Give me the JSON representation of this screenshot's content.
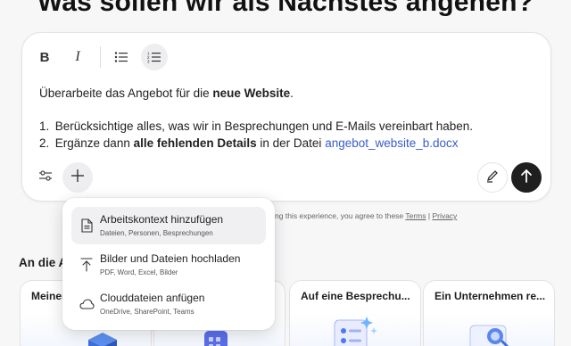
{
  "headline": "Was sollen wir als Nächstes angehen?",
  "toolbar": {
    "bold_label": "B",
    "italic_label": "I"
  },
  "editor": {
    "line1_prefix": "Überarbeite das Angebot für die ",
    "line1_bold": "neue Website",
    "line1_suffix": ".",
    "item1_number": "1.",
    "item1_text": "Berücksichtige alles, was wir in Besprechungen und E-Mails vereinbart haben.",
    "item2_number": "2.",
    "item2_prefix": "Ergänze dann ",
    "item2_bold": "alle fehlenden Details",
    "item2_middle": " in der Datei ",
    "item2_file": "angebot_website_b.docx"
  },
  "disclaimer": {
    "text": "ising this experience, you agree to these ",
    "terms": "Terms",
    "separator": " | ",
    "privacy": "Privacy"
  },
  "section_label": "An die A",
  "cards": [
    {
      "title": "Meiner"
    },
    {
      "title": ""
    },
    {
      "title": "Auf eine Besprechu..."
    },
    {
      "title": "Ein Unternehmen re..."
    }
  ],
  "popup": {
    "items": [
      {
        "title": "Arbeitskontext hinzufügen",
        "subtitle": "Dateien, Personen, Besprechungen",
        "icon": "document-icon"
      },
      {
        "title": "Bilder und Dateien hochladen",
        "subtitle": "PDF, Word, Excel, Bilder",
        "icon": "upload-icon"
      },
      {
        "title": "Clouddateien anfügen",
        "subtitle": "OneDrive, SharePoint, Teams",
        "icon": "cloud-icon"
      }
    ]
  },
  "colors": {
    "link": "#3a5ccc",
    "send_button": "#1f1f1f",
    "page_background": "#f7f7f8"
  }
}
